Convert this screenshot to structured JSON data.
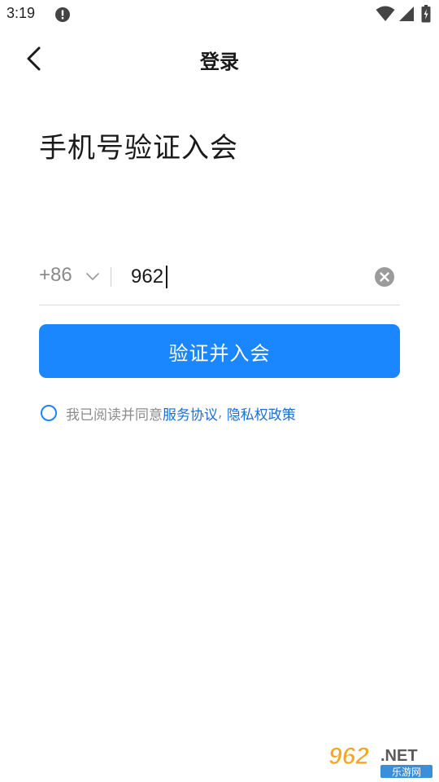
{
  "status_bar": {
    "time": "3:19",
    "icons": [
      "alert-icon",
      "wifi-icon",
      "signal-icon",
      "battery-icon"
    ]
  },
  "nav": {
    "title": "登录",
    "back_icon": "back-icon"
  },
  "heading": "手机号验证入会",
  "phone": {
    "country_code": "+86",
    "value": "962",
    "clear_icon": "clear-icon"
  },
  "submit_label": "验证并入会",
  "agreement": {
    "prefix": "我已阅读并同意",
    "service_link": "服务协议",
    "separator": ", ",
    "privacy_link": "隐私权政策"
  },
  "watermark": {
    "number": "962",
    "suffix": ".NET",
    "sub": "乐游网"
  },
  "colors": {
    "accent": "#1a86ff",
    "link": "#1a6fd6",
    "muted_text": "#8c8c8c"
  }
}
